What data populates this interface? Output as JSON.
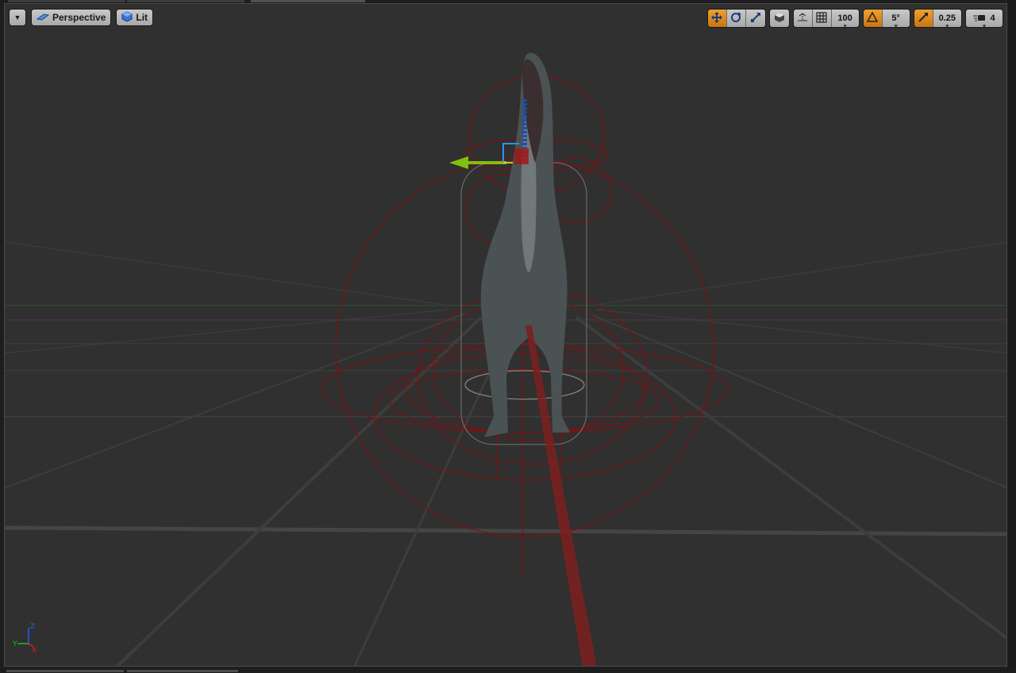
{
  "viewport": {
    "menu_icon": "chevron-down-icon",
    "view_mode_label": "Perspective",
    "view_mode_icon": "perspective-icon",
    "lighting_label": "Lit",
    "lighting_icon": "lit-sphere-icon"
  },
  "toolbar": {
    "translate_icon": "translate-icon",
    "rotate_icon": "rotate-icon",
    "scale_icon": "scale-icon",
    "coordinate_space_icon": "world-space-icon",
    "surface_snap_icon": "surface-snap-icon",
    "grid_snap_icon": "grid-snap-icon",
    "grid_snap_value": "100",
    "rotation_snap_icon": "rotation-snap-icon",
    "rotation_snap_value": "5°",
    "scale_snap_icon": "scale-snap-icon",
    "scale_snap_value": "0.25",
    "camera_speed_icon": "camera-speed-icon",
    "camera_speed_value": "4"
  },
  "axis_indicator": {
    "x_label": "X",
    "y_label": "Y",
    "z_label": "Z",
    "x_color": "#e02020",
    "y_color": "#20c020",
    "z_color": "#2060ff"
  },
  "colors": {
    "viewport_bg": "#303030",
    "active_toggle": "#e8962a",
    "physics_body": "#8a1414",
    "gizmo_y_arrow": "#7fc010"
  }
}
